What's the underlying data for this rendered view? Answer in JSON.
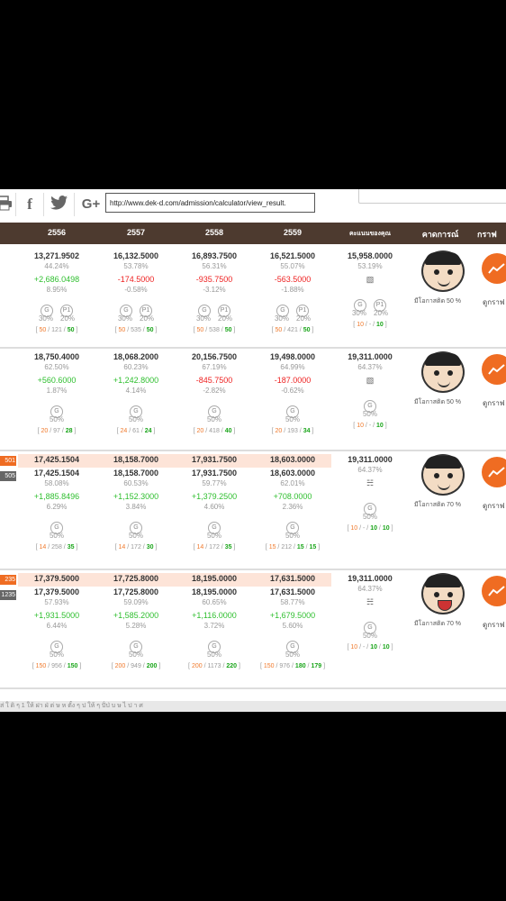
{
  "share": {
    "icons": [
      "print-icon",
      "facebook-icon",
      "twitter-icon",
      "google-plus-icon"
    ],
    "google_plus_label": "G+",
    "facebook_label": "f",
    "url": "http://www.dek-d.com/admission/calculator/view_result."
  },
  "header": {
    "col_2556": "2556",
    "col_2557": "2557",
    "col_2558": "2558",
    "col_2559": "2559",
    "your_score": "คะแนนของคุณ",
    "prediction": "คาดการณ์",
    "graph": "กราฟ"
  },
  "rows": [
    {
      "tags": [],
      "years": [
        {
          "top": "13,271.9502",
          "pct": "44.24%",
          "diff": "+2,686.0498",
          "dpct": "8.95%",
          "w1": "30%",
          "w2": "20%",
          "r1": "50",
          "r2": "121",
          "r3": "50"
        },
        {
          "top": "16,132.5000",
          "pct": "53.78%",
          "diff": "-174.5000",
          "dpct": "-0.58%",
          "w1": "30%",
          "w2": "20%",
          "r1": "50",
          "r2": "535",
          "r3": "50"
        },
        {
          "top": "16,893.7500",
          "pct": "56.31%",
          "diff": "-935.7500",
          "dpct": "-3.12%",
          "w1": "30%",
          "w2": "20%",
          "r1": "50",
          "r2": "538",
          "r3": "50"
        },
        {
          "top": "16,521.5000",
          "pct": "55.07%",
          "diff": "-563.5000",
          "dpct": "-1.88%",
          "w1": "30%",
          "w2": "20%",
          "r1": "50",
          "r2": "421",
          "r3": "50"
        }
      ],
      "your": {
        "score": "15,958.0000",
        "pct": "53.19%",
        "w1": "30%",
        "w2": "20%",
        "r1": "10",
        "r2": "-",
        "r3": "10"
      },
      "chance": "มีโอกาสติด 50 %",
      "graph_label": "ดูกราฟ"
    },
    {
      "tags": [],
      "years": [
        {
          "top": "18,750.4000",
          "pct": "62.50%",
          "diff": "+560.6000",
          "dpct": "1.87%",
          "w1": "50%",
          "r1": "20",
          "r2": "97",
          "r3": "28"
        },
        {
          "top": "18,068.2000",
          "pct": "60.23%",
          "diff": "+1,242.8000",
          "dpct": "4.14%",
          "w1": "50%",
          "r1": "24",
          "r2": "61",
          "r3": "24"
        },
        {
          "top": "20,156.7500",
          "pct": "67.19%",
          "diff": "-845.7500",
          "dpct": "-2.82%",
          "w1": "50%",
          "r1": "20",
          "r2": "418",
          "r3": "40"
        },
        {
          "top": "19,498.0000",
          "pct": "64.99%",
          "diff": "-187.0000",
          "dpct": "-0.62%",
          "w1": "50%",
          "r1": "20",
          "r2": "193",
          "r3": "34"
        }
      ],
      "your": {
        "score": "19,311.0000",
        "pct": "64.37%",
        "w1": "50%",
        "r1": "10",
        "r2": "-",
        "r3": "10"
      },
      "chance": "มีโอกาสติด 50 %",
      "graph_label": "ดูกราฟ"
    },
    {
      "tags": [
        "501",
        "505"
      ],
      "years": [
        {
          "hl": "17,425.1504",
          "top": "17,425.1504",
          "pct": "58.08%",
          "diff": "+1,885.8496",
          "dpct": "6.29%",
          "w1": "50%",
          "r1": "14",
          "r2": "258",
          "r3": "35"
        },
        {
          "hl": "18,158.7000",
          "top": "18,158.7000",
          "pct": "60.53%",
          "diff": "+1,152.3000",
          "dpct": "3.84%",
          "w1": "50%",
          "r1": "14",
          "r2": "172",
          "r3": "30"
        },
        {
          "hl": "17,931.7500",
          "top": "17,931.7500",
          "pct": "59.77%",
          "diff": "+1,379.2500",
          "dpct": "4.60%",
          "w1": "50%",
          "r1": "14",
          "r2": "172",
          "r3": "35"
        },
        {
          "hl": "18,603.0000",
          "top": "18,603.0000",
          "pct": "62.01%",
          "diff": "+708.0000",
          "dpct": "2.36%",
          "w1": "50%",
          "r1": "15",
          "r2": "212",
          "r3": "15",
          "r4": "15"
        }
      ],
      "your": {
        "score": "19,311.0000",
        "pct": "64.37%",
        "w1": "50%",
        "r1": "10",
        "r2": "-",
        "r3": "10",
        "r4": "10"
      },
      "chance": "มีโอกาสติด 70 %",
      "graph_label": "ดูกราฟ"
    },
    {
      "tags": [
        "235",
        "1235"
      ],
      "years": [
        {
          "hl": "17,379.5000",
          "top": "17,379.5000",
          "pct": "57.93%",
          "diff": "+1,931.5000",
          "dpct": "6.44%",
          "w1": "50%",
          "r1": "150",
          "r2": "956",
          "r3": "150"
        },
        {
          "hl": "17,725.8000",
          "top": "17,725.8000",
          "pct": "59.09%",
          "diff": "+1,585.2000",
          "dpct": "5.28%",
          "w1": "50%",
          "r1": "200",
          "r2": "949",
          "r3": "200"
        },
        {
          "hl": "18,195.0000",
          "top": "18,195.0000",
          "pct": "60.65%",
          "diff": "+1,116.0000",
          "dpct": "3.72%",
          "w1": "50%",
          "r1": "200",
          "r2": "1173",
          "r3": "220"
        },
        {
          "hl": "17,631.5000",
          "top": "17,631.5000",
          "pct": "58.77%",
          "diff": "+1,679.5000",
          "dpct": "5.60%",
          "w1": "50%",
          "r1": "150",
          "r2": "976",
          "r3": "180",
          "r4": "179"
        }
      ],
      "your": {
        "score": "19,311.0000",
        "pct": "64.37%",
        "w1": "50%",
        "r1": "10",
        "r2": "-",
        "r3": "10",
        "r4": "10"
      },
      "chance": "มีโอกาสติด 70 %",
      "graph_label": "ดูกราฟ"
    }
  ],
  "footer_text": "ส่ ใ ดิ  ๆ 1 ให้   ฝา  ฝ่    ต่       ษ  ห  ตั้ง ๆ  ป     ให้ ๆ ปั่ป่ บ  ษ   ไ    ป    า ศ"
}
